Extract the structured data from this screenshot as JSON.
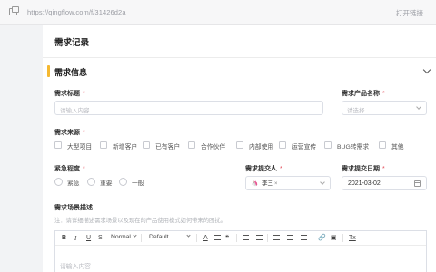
{
  "browser": {
    "url": "https://qingflow.com/f/31426d2a",
    "open_link_label": "打开链接"
  },
  "page": {
    "title": "需求记录"
  },
  "section": {
    "title": "需求信息"
  },
  "fields": {
    "title_label": "需求标题",
    "title_placeholder": "请输入内容",
    "product_label": "需求产品名称",
    "product_placeholder": "请选择",
    "source_label": "需求来源",
    "source_options": [
      "大型项目",
      "新增客户",
      "已有客户",
      "合作伙伴",
      "内部使用",
      "运营宣传",
      "BUG转需求",
      "其他"
    ],
    "urgency_label": "紧急程度",
    "urgency_options": [
      "紧急",
      "重要",
      "一般"
    ],
    "submitter_label": "需求提交人",
    "submitter_value": "李三",
    "submitter_avatar": "🦄",
    "submit_date_label": "需求提交日期",
    "submit_date_value": "2021-03-02",
    "scene_label": "需求场景描述",
    "scene_hint": "注：请详细描述需求场景以及现在的产品使用模式如何带来的困扰。",
    "editor_placeholder": "请输入内容",
    "required_mark": "*"
  },
  "editor_toolbar": {
    "bold": "B",
    "italic": "I",
    "underline": "U",
    "strike": "S",
    "format_select": "Normal",
    "font_select": "Default",
    "color_a": "A",
    "quote": "❝",
    "clear": "Tx"
  },
  "colors": {
    "accent_bar": "#f5b830",
    "required": "#e34d59",
    "page_bg": "#f2f3f5"
  }
}
